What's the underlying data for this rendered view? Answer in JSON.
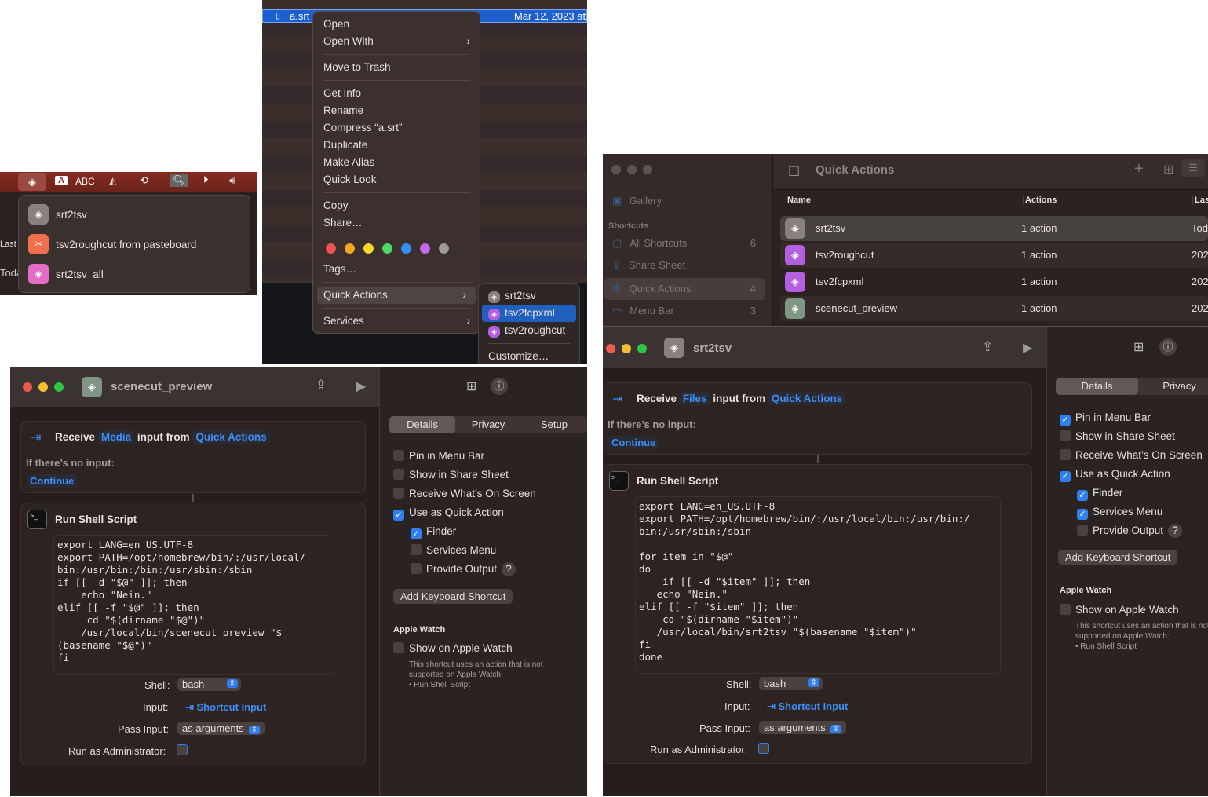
{
  "menubar": {
    "abc_label": "ABC",
    "input_badge": "A",
    "dropdown": [
      {
        "label": "srt2tsv",
        "color": "#8a807c"
      },
      {
        "label": "tsv2roughcut from pasteboard",
        "color": "#f0704e"
      },
      {
        "label": "srt2tsv_all",
        "color": "#e46bc6"
      }
    ],
    "bg_fragments": {
      "last": "Last",
      "today": "Toda"
    }
  },
  "finder": {
    "file_name": "a.srt",
    "date": "Mar 12, 2023 at",
    "menu": {
      "open": "Open",
      "open_with": "Open With",
      "move_to_trash": "Move to Trash",
      "get_info": "Get Info",
      "rename": "Rename",
      "compress": "Compress “a.srt”",
      "duplicate": "Duplicate",
      "make_alias": "Make Alias",
      "quick_look": "Quick Look",
      "copy": "Copy",
      "share": "Share…",
      "tags": "Tags…",
      "quick_actions": "Quick Actions",
      "services": "Services",
      "tag_colors": [
        "#f0524f",
        "#f5a623",
        "#f5d829",
        "#4cd964",
        "#2f8ff5",
        "#c767f0",
        "#9b9b9b"
      ]
    },
    "submenu": {
      "items": [
        {
          "label": "srt2tsv",
          "color": "#8a807c"
        },
        {
          "label": "tsv2fcpxml",
          "color": "#b45ee0",
          "selected": true
        },
        {
          "label": "tsv2roughcut",
          "color": "#b45ee0"
        }
      ],
      "customize": "Customize…"
    }
  },
  "editor_left": {
    "title": "scenecut_preview",
    "icon_color": "#7f9684",
    "receive": "Receive",
    "input_type": "Media",
    "input_from": "input from",
    "source": "Quick Actions",
    "no_input": "If there’s no input:",
    "continue": "Continue",
    "action_title": "Run Shell Script",
    "code": "export LANG=en_US.UTF-8\nexport PATH=/opt/homebrew/bin/:/usr/local/\nbin:/usr/bin:/bin:/usr/sbin:/sbin\nif [[ -d \"$@\" ]]; then\n    echo \"Nein.\"\nelif [[ -f \"$@\" ]]; then\n     cd \"$(dirname \"$@\")\"\n    /usr/local/bin/scenecut_preview \"$\n(basename \"$@\")\"\nfi",
    "shell_label": "Shell:",
    "shell": "bash",
    "input_label": "Input:",
    "input": "Shortcut Input",
    "pass_label": "Pass Input:",
    "pass": "as arguments",
    "admin_label": "Run as Administrator:",
    "tabs": [
      "Details",
      "Privacy",
      "Setup"
    ],
    "options": [
      {
        "label": "Pin in Menu Bar",
        "checked": false
      },
      {
        "label": "Show in Share Sheet",
        "checked": false
      },
      {
        "label": "Receive What’s On Screen",
        "checked": false
      },
      {
        "label": "Use as Quick Action",
        "checked": true
      },
      {
        "label": "Finder",
        "checked": true
      },
      {
        "label": "Services Menu",
        "checked": false
      },
      {
        "label": "Provide Output",
        "checked": false
      }
    ],
    "help": "?",
    "add_shortcut": "Add Keyboard Shortcut",
    "watch_heading": "Apple Watch",
    "watch_option": "Show on Apple Watch",
    "watch_note": "This shortcut uses an action that is not\nsupported on Apple Watch:\n• Run Shell Script"
  },
  "library": {
    "title": "Quick Actions",
    "sidebar": {
      "gallery": "Gallery",
      "section": "Shortcuts",
      "items": [
        {
          "label": "All Shortcuts",
          "count": "6"
        },
        {
          "label": "Share Sheet",
          "count": ""
        },
        {
          "label": "Quick Actions",
          "count": "4",
          "selected": true
        },
        {
          "label": "Menu Bar",
          "count": "3"
        }
      ]
    },
    "columns": [
      "Name",
      "Actions",
      "Last"
    ],
    "rows": [
      {
        "name": "srt2tsv",
        "actions": "1 action",
        "last": "Tod",
        "color": "#8a807c"
      },
      {
        "name": "tsv2roughcut",
        "actions": "1 action",
        "last": "202",
        "color": "#b45ee0"
      },
      {
        "name": "tsv2fcpxml",
        "actions": "1 action",
        "last": "202",
        "color": "#b45ee0"
      },
      {
        "name": "scenecut_preview",
        "actions": "1 action",
        "last": "202",
        "color": "#7f9684"
      }
    ]
  },
  "editor_right": {
    "title": "srt2tsv",
    "icon_color": "#8a807c",
    "receive": "Receive",
    "input_type": "Files",
    "input_from": "input from",
    "source": "Quick Actions",
    "no_input": "If there’s no input:",
    "continue": "Continue",
    "action_title": "Run Shell Script",
    "code": "export LANG=en_US.UTF-8\nexport PATH=/opt/homebrew/bin/:/usr/local/bin:/usr/bin:/\nbin:/usr/sbin:/sbin\n\nfor item in \"$@\"\ndo\n    if [[ -d \"$item\" ]]; then\n   echo \"Nein.\"\nelif [[ -f \"$item\" ]]; then\n    cd \"$(dirname \"$item\")\"\n   /usr/local/bin/srt2tsv \"$(basename \"$item\")\"\nfi\ndone",
    "shell_label": "Shell:",
    "shell": "bash",
    "input_label": "Input:",
    "input": "Shortcut Input",
    "pass_label": "Pass Input:",
    "pass": "as arguments",
    "admin_label": "Run as Administrator:",
    "tabs": [
      "Details",
      "Privacy"
    ],
    "options": [
      {
        "label": "Pin in Menu Bar",
        "checked": true
      },
      {
        "label": "Show in Share Sheet",
        "checked": false
      },
      {
        "label": "Receive What’s On Screen",
        "checked": false
      },
      {
        "label": "Use as Quick Action",
        "checked": true
      },
      {
        "label": "Finder",
        "checked": true
      },
      {
        "label": "Services Menu",
        "checked": true
      },
      {
        "label": "Provide Output",
        "checked": false
      }
    ],
    "help": "?",
    "add_shortcut": "Add Keyboard Shortcut",
    "watch_heading": "Apple Watch",
    "watch_option": "Show on Apple Watch",
    "watch_note": "This shortcut uses an action that is not\nsupported on Apple Watch:\n• Run Shell Script"
  }
}
